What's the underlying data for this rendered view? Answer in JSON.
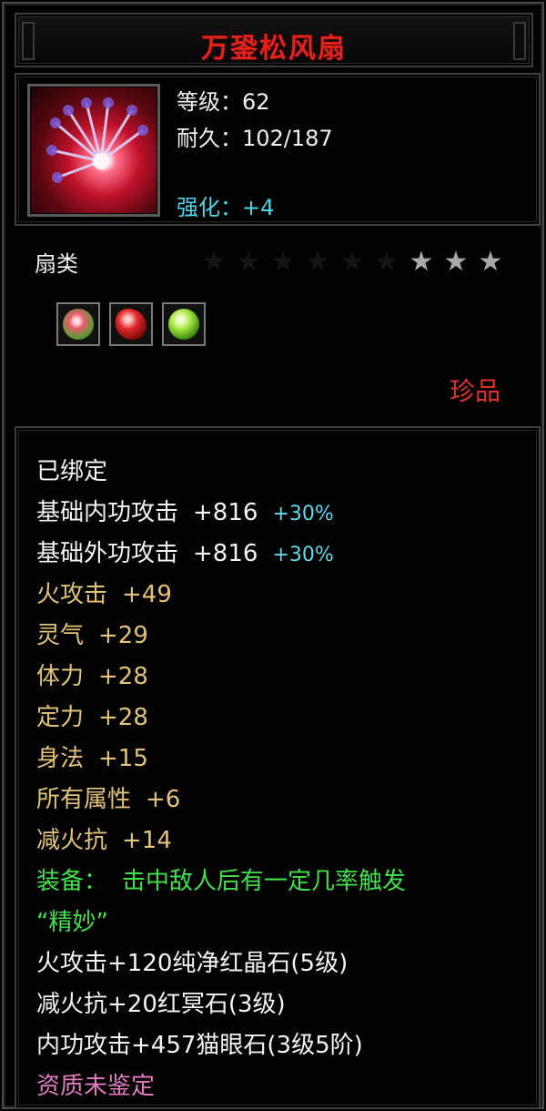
{
  "window": {
    "title": "万銎松风扇"
  },
  "header": {
    "icon": "fan-weapon-icon",
    "level": {
      "label": "等级",
      "sep": "：",
      "value": "62"
    },
    "durability": {
      "label": "耐久",
      "sep": "：",
      "value": "102/187"
    },
    "enhance": {
      "label": "强化",
      "sep": "：",
      "value": "+4"
    }
  },
  "category": "扇类",
  "stars": {
    "total": 9,
    "lit": 3,
    "icon": "star-icon"
  },
  "gems": [
    {
      "name": "cat-eye-gem-icon"
    },
    {
      "name": "red-crystal-gem-icon"
    },
    {
      "name": "green-gem-icon"
    }
  ],
  "rarity": "珍品",
  "attributes": {
    "bound": "已绑定",
    "base_inner": {
      "label": "基础内功攻击",
      "value": "+816",
      "bonus": "+30%"
    },
    "base_outer": {
      "label": "基础外功攻击",
      "value": "+816",
      "bonus": "+30%"
    },
    "stats": [
      {
        "label": "火攻击",
        "value": "+49"
      },
      {
        "label": "灵气",
        "value": "+29"
      },
      {
        "label": "体力",
        "value": "+28"
      },
      {
        "label": "定力",
        "value": "+28"
      },
      {
        "label": "身法",
        "value": "+15"
      },
      {
        "label": "所有属性",
        "value": "+6"
      },
      {
        "label": "减火抗",
        "value": "+14"
      }
    ],
    "equip_label": "装备：",
    "equip_effect": "击中敌人后有一定几率触发",
    "equip_effect_name": "“精妙”",
    "gem_bonuses": [
      "火攻击+120纯净红晶石(5级)",
      "减火抗+20红冥石(3级)",
      "内功攻击+457猫眼石(3级5阶)"
    ],
    "quality": "资质未鉴定"
  },
  "colors": {
    "title": "#e0231c",
    "white_text": "#f4f4f4",
    "gold_text": "#e3c27a",
    "cyan_text": "#63d7ea",
    "green_text": "#44e04c",
    "pink_text": "#e27bc0",
    "rarity": "#e03232"
  }
}
